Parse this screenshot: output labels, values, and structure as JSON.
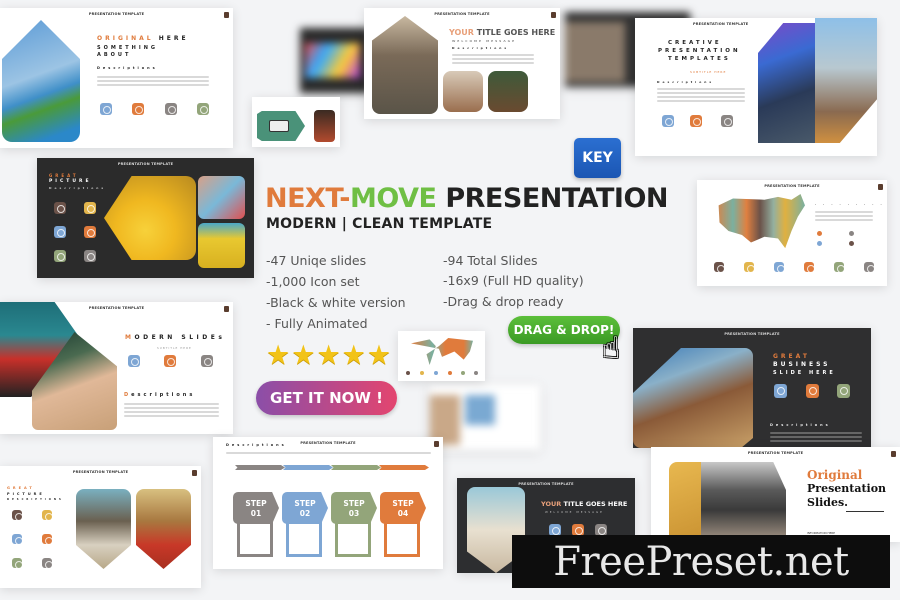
{
  "hero": {
    "title_part1": "NEXT-",
    "title_part2": "MOVE",
    "title_part3": " PRESENTATION",
    "subtitle": "MODERN | CLEAN TEMPLATE",
    "features_left": [
      "-47 Uniqe slides",
      "-1,000 Icon set",
      "-Black & white version",
      "- Fully Animated"
    ],
    "features_right": [
      "-94 Total Slides",
      "-16x9 (Full HD quality)",
      "-Drag & drop ready"
    ],
    "rating_stars": 5,
    "rating_max": 5,
    "cta_label": "GET IT NOW !",
    "drag_drop_label": "DRAG & DROP!",
    "key_badge": "KEY",
    "star_glyph": "★",
    "cursor_icon": "hand-pointer-icon",
    "cursor_glyph": "☝"
  },
  "colors": {
    "orange": "#e07b3c",
    "green": "#6fbf44",
    "blue_key": "#2b6fd1",
    "gradient_start": "#8b4ea8",
    "gradient_end": "#e3456f"
  },
  "slides": {
    "header": "PRESENTATION TEMPLATE",
    "s1": {
      "title_a": "ORIGINAL",
      "title_b": " HERE",
      "line2": "SOMETHING",
      "line3": "ABOUT",
      "desc": "Descriptions"
    },
    "s2": {
      "title_a": "YOUR",
      "title_b": " TITLE GOES HERE",
      "tagline": "WELCOME MESSAGE",
      "desc": "Descriptions"
    },
    "s3": {
      "line1": "CREATIVE",
      "line2": "PRESENTATION",
      "line3": "TEMPLATES",
      "tagline": "SUBTITLE HERE",
      "desc": "Descriptions"
    },
    "s4": {
      "line1": "GREAT",
      "line2": "PICTURE",
      "desc": "Descriptions"
    },
    "s5": {
      "desc": "Descriptions"
    },
    "s6": {
      "title": "MODERN SLIDES",
      "tagline": "SUBTITLE HERE",
      "desc": "Descriptions"
    },
    "s7": {
      "line1": "GREAT",
      "line2": "BUSINESS",
      "line3": "SLIDE HERE",
      "desc": "Descriptions"
    },
    "s8": {
      "line1": "GREAT",
      "line2": "PICTURE",
      "line3": "DESCRIPTIONS"
    },
    "s9": {
      "desc": "Descriptions",
      "steps": [
        {
          "label": "STEP",
          "num": "01"
        },
        {
          "label": "STEP",
          "num": "02"
        },
        {
          "label": "STEP",
          "num": "03"
        },
        {
          "label": "STEP",
          "num": "04"
        }
      ]
    },
    "s10": {
      "title_a": "YOUR",
      "title_b": " TITLE GOES HERE",
      "tagline": "WELCOME MESSAGE"
    },
    "s11": {
      "line1": "Original",
      "line2": "Presentation",
      "line3": "Slides.",
      "sub": "INFORMATION HERE"
    }
  },
  "watermark": "FreePreset.net"
}
